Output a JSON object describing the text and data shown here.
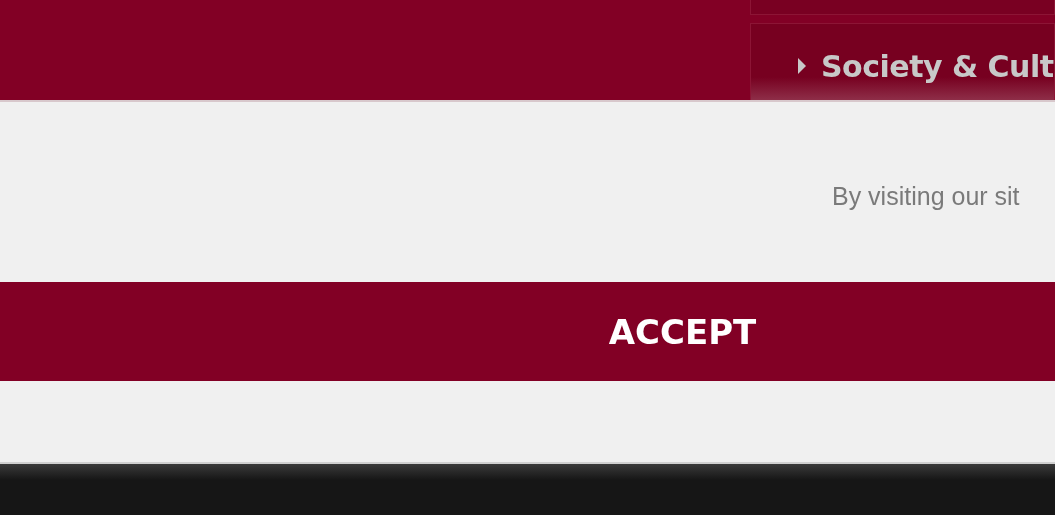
{
  "menu": {
    "items": [
      {
        "label": "Society & Cult"
      }
    ]
  },
  "cookie_notice": {
    "message": "By visiting our sit",
    "accept_button": "ACCEPT"
  }
}
